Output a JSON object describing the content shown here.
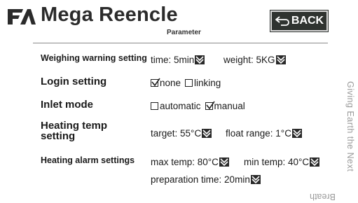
{
  "header": {
    "brand": "Mega Reencle",
    "subtitle": "Parameter",
    "back_label": "BACK",
    "logo_icon": "fa-monogram-icon",
    "back_icon": "return-arrow-icon"
  },
  "rows": {
    "weighing": {
      "label": "Weighing warning setting",
      "time": "time: 5min",
      "weight": "weight: 5KG"
    },
    "login": {
      "label": "Login setting",
      "options": [
        {
          "label": "none",
          "checked": true
        },
        {
          "label": "linking",
          "checked": false
        }
      ]
    },
    "inlet": {
      "label": "Inlet mode",
      "options": [
        {
          "label": "automatic",
          "checked": false
        },
        {
          "label": "manual",
          "checked": true
        }
      ]
    },
    "heating": {
      "label_line1": "Heating temp",
      "label_line2": "setting",
      "target": "target: 55°C",
      "float_range": "float range: 1°C"
    },
    "alarm": {
      "label": "Heating alarm settings",
      "max_temp": "max temp: 80°C",
      "min_temp": "min temp: 40°C",
      "preparation_time": "preparation time: 20min"
    }
  },
  "side_text": {
    "vertical": "Giving Earth the Next",
    "bottom": "Breath"
  },
  "colors": {
    "button_bg": "#2f3330",
    "text": "#1a1a1a",
    "faint_text": "#9a9a9a"
  }
}
